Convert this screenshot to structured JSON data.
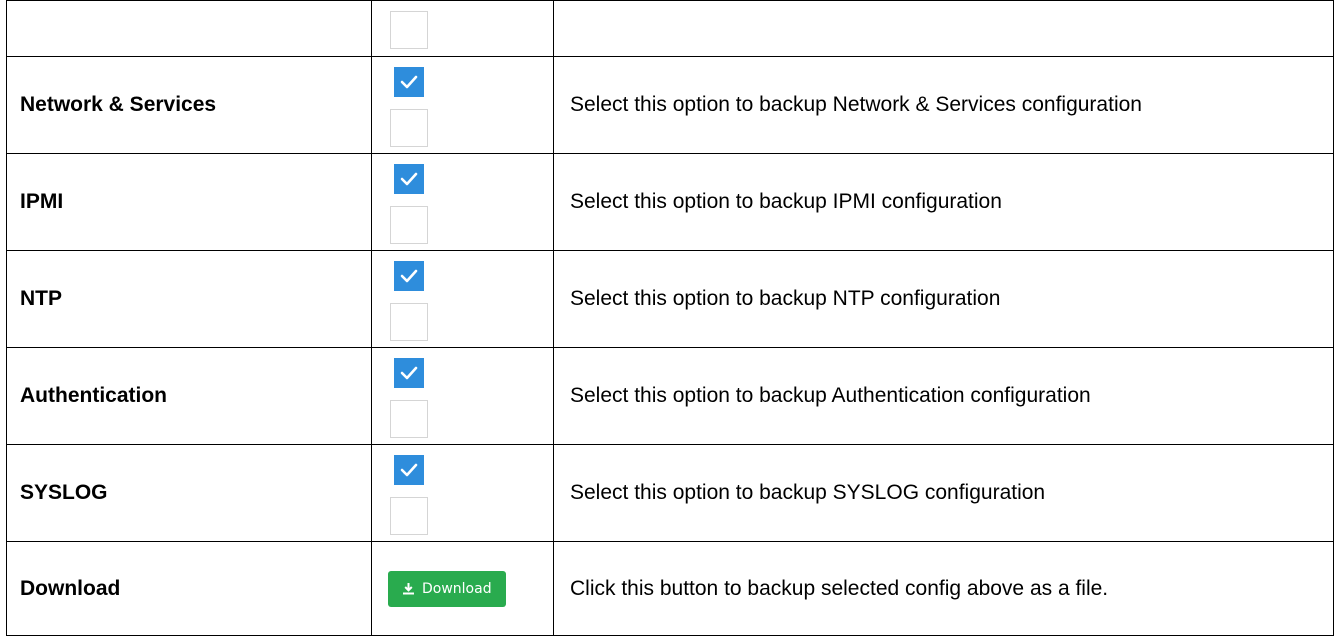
{
  "rows": [
    {
      "name": "",
      "checked": false,
      "description": ""
    },
    {
      "name": "Network & Services",
      "checked": true,
      "description": "Select this option to backup Network & Services configuration"
    },
    {
      "name": "IPMI",
      "checked": true,
      "description": "Select this option to backup IPMI configuration"
    },
    {
      "name": "NTP",
      "checked": true,
      "description": "Select this option to backup NTP configuration"
    },
    {
      "name": "Authentication",
      "checked": true,
      "description": "Select this option to backup Authentication configuration"
    },
    {
      "name": "SYSLOG",
      "checked": true,
      "description": "Select this option to backup SYSLOG configuration"
    }
  ],
  "download": {
    "name": "Download",
    "button_label": "Download",
    "button_icon": "download-icon",
    "description": "Click this button to backup selected config above as a file."
  },
  "colors": {
    "checkbox_checked": "#2e8ddc",
    "button_green": "#29ab4e",
    "checkbox_border": "#d5d5d5"
  }
}
